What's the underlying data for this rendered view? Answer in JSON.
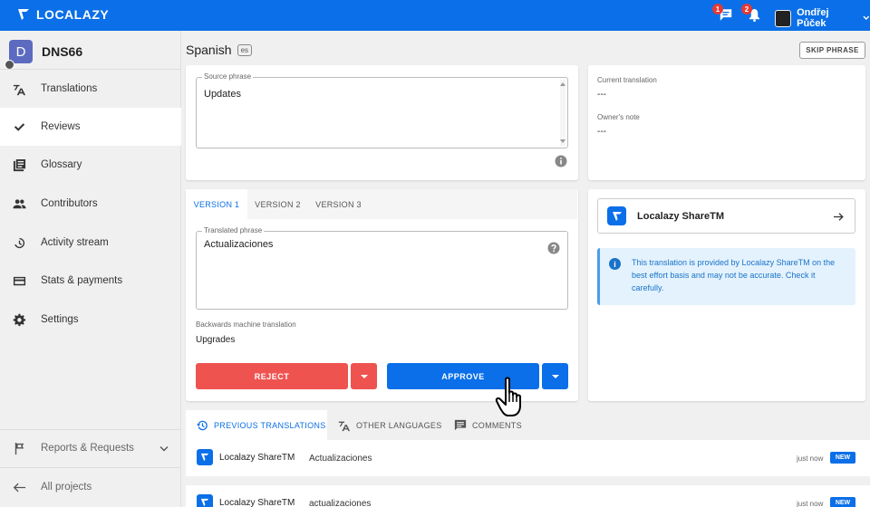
{
  "app": {
    "brand": "LOCALAZY"
  },
  "header": {
    "messages_badge": "1",
    "notifications_badge": "2",
    "user_name": "Ondřej Půček"
  },
  "project": {
    "initial": "D",
    "name": "DNS66"
  },
  "sidebar": {
    "items": [
      {
        "label": "Translations",
        "icon": "translate-icon"
      },
      {
        "label": "Reviews",
        "icon": "check-icon",
        "active": true
      },
      {
        "label": "Glossary",
        "icon": "book-icon"
      },
      {
        "label": "Contributors",
        "icon": "people-icon"
      },
      {
        "label": "Activity stream",
        "icon": "history-icon"
      },
      {
        "label": "Stats & payments",
        "icon": "card-icon"
      },
      {
        "label": "Settings",
        "icon": "gear-icon"
      }
    ],
    "reports": "Reports & Requests",
    "all_projects": "All projects"
  },
  "main": {
    "language": "Spanish",
    "language_code": "es",
    "skip_label": "SKIP PHRASE",
    "source_label": "Source phrase",
    "source_value": "Updates",
    "current_translation_label": "Current translation",
    "current_translation_value": "---",
    "owners_note_label": "Owner's note",
    "owners_note_value": "---",
    "versions": [
      "VERSION 1",
      "VERSION 2",
      "VERSION 3"
    ],
    "translated_label": "Translated phrase",
    "translated_value": "Actualizaciones",
    "backwards_label": "Backwards machine translation",
    "backwards_value": "Upgrades",
    "reject_label": "REJECT",
    "approve_label": "APPROVE"
  },
  "sharetm": {
    "title": "Localazy ShareTM",
    "info": "This translation is provided by Localazy ShareTM on the best effort basis and may not be accurate. Check it carefully."
  },
  "bottom_tabs": [
    "PREVIOUS TRANSLATIONS",
    "OTHER LANGUAGES",
    "COMMENTS"
  ],
  "history": [
    {
      "source": "Localazy ShareTM",
      "text": "Actualizaciones",
      "time": "just now",
      "badge": "NEW"
    },
    {
      "source": "Localazy ShareTM",
      "text": "actualizaciones",
      "time": "just now",
      "badge": "NEW"
    }
  ],
  "colors": {
    "brand": "#0a6fe8",
    "reject": "#ef5350",
    "info_bg": "#e3f2fd"
  }
}
